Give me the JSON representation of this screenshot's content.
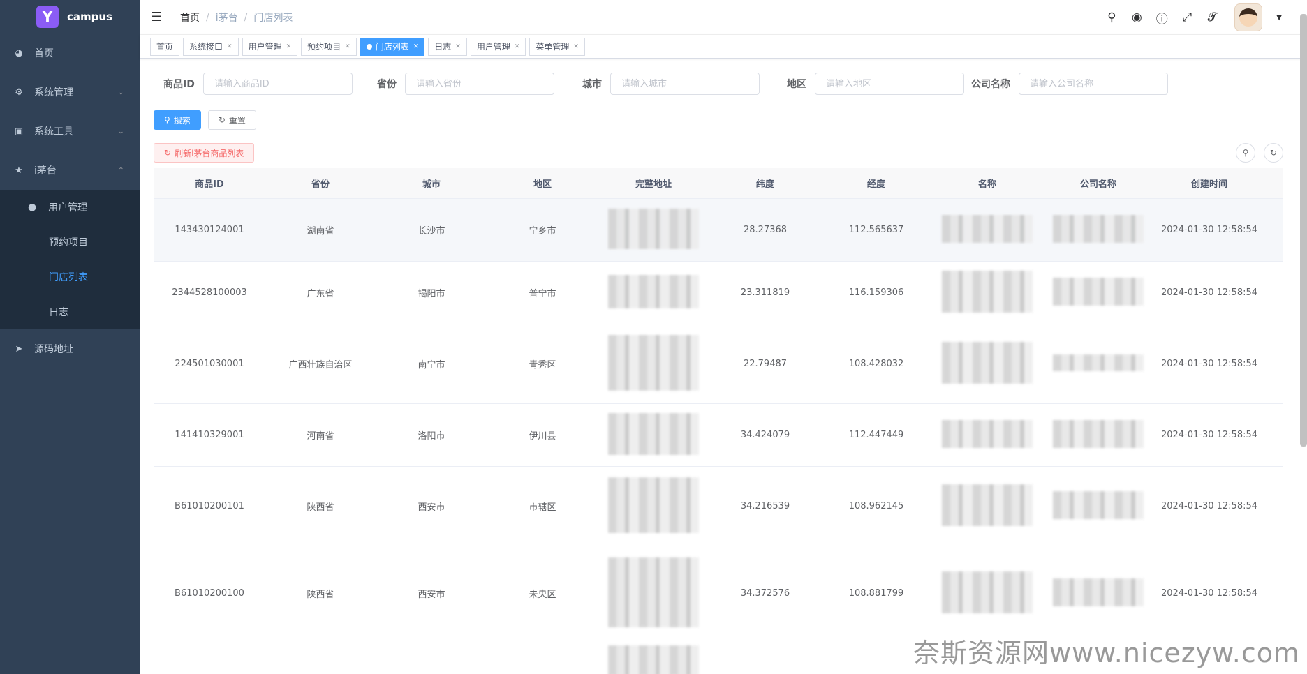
{
  "app": {
    "logo_text": "campus",
    "logo_letter": "Y"
  },
  "sidebar": {
    "items": [
      {
        "label": "首页",
        "icon": "dashboard-icon"
      },
      {
        "label": "系统管理",
        "icon": "gear-icon"
      },
      {
        "label": "系统工具",
        "icon": "toolbox-icon"
      },
      {
        "label": "i茅台",
        "icon": "star-icon"
      }
    ],
    "sub_items": [
      {
        "label": "用户管理",
        "icon": "user-icon"
      },
      {
        "label": "预约项目"
      },
      {
        "label": "门店列表"
      },
      {
        "label": "日志"
      }
    ],
    "source_link": {
      "label": "源码地址",
      "icon": "send-icon"
    }
  },
  "breadcrumb": [
    "首页",
    "i茅台",
    "门店列表"
  ],
  "tags": [
    {
      "label": "首页",
      "closable": false
    },
    {
      "label": "系统接口",
      "closable": true
    },
    {
      "label": "用户管理",
      "closable": true
    },
    {
      "label": "预约项目",
      "closable": true
    },
    {
      "label": "门店列表",
      "closable": true,
      "active": true
    },
    {
      "label": "日志",
      "closable": true
    },
    {
      "label": "用户管理",
      "closable": true
    },
    {
      "label": "菜单管理",
      "closable": true
    }
  ],
  "search": {
    "fields": [
      {
        "label": "商品ID",
        "placeholder": "请输入商品ID"
      },
      {
        "label": "省份",
        "placeholder": "请输入省份"
      },
      {
        "label": "城市",
        "placeholder": "请输入城市"
      },
      {
        "label": "地区",
        "placeholder": "请输入地区"
      },
      {
        "label": "公司名称",
        "placeholder": "请输入公司名称"
      }
    ],
    "search_label": "搜索",
    "reset_label": "重置",
    "refresh_label": "刷新i茅台商品列表"
  },
  "table": {
    "columns": [
      "商品ID",
      "省份",
      "城市",
      "地区",
      "完整地址",
      "纬度",
      "经度",
      "名称",
      "公司名称",
      "创建时间"
    ],
    "rows": [
      {
        "id": "143430124001",
        "province": "湖南省",
        "city": "长沙市",
        "district": "宁乡市",
        "lat": "28.27368",
        "lng": "112.565637",
        "time": "2024-01-30 12:58:54"
      },
      {
        "id": "2344528100003",
        "province": "广东省",
        "city": "揭阳市",
        "district": "普宁市",
        "lat": "23.311819",
        "lng": "116.159306",
        "time": "2024-01-30 12:58:54"
      },
      {
        "id": "224501030001",
        "province": "广西壮族自治区",
        "city": "南宁市",
        "district": "青秀区",
        "lat": "22.79487",
        "lng": "108.428032",
        "time": "2024-01-30 12:58:54"
      },
      {
        "id": "141410329001",
        "province": "河南省",
        "city": "洛阳市",
        "district": "伊川县",
        "lat": "34.424079",
        "lng": "112.447449",
        "time": "2024-01-30 12:58:54"
      },
      {
        "id": "B61010200101",
        "province": "陕西省",
        "city": "西安市",
        "district": "市辖区",
        "lat": "34.216539",
        "lng": "108.962145",
        "time": "2024-01-30 12:58:54"
      },
      {
        "id": "B61010200100",
        "province": "陕西省",
        "city": "西安市",
        "district": "未央区",
        "lat": "34.372576",
        "lng": "108.881799",
        "time": "2024-01-30 12:58:54"
      }
    ]
  },
  "footer_watermark": "奈斯资源网www.nicezyw.com"
}
